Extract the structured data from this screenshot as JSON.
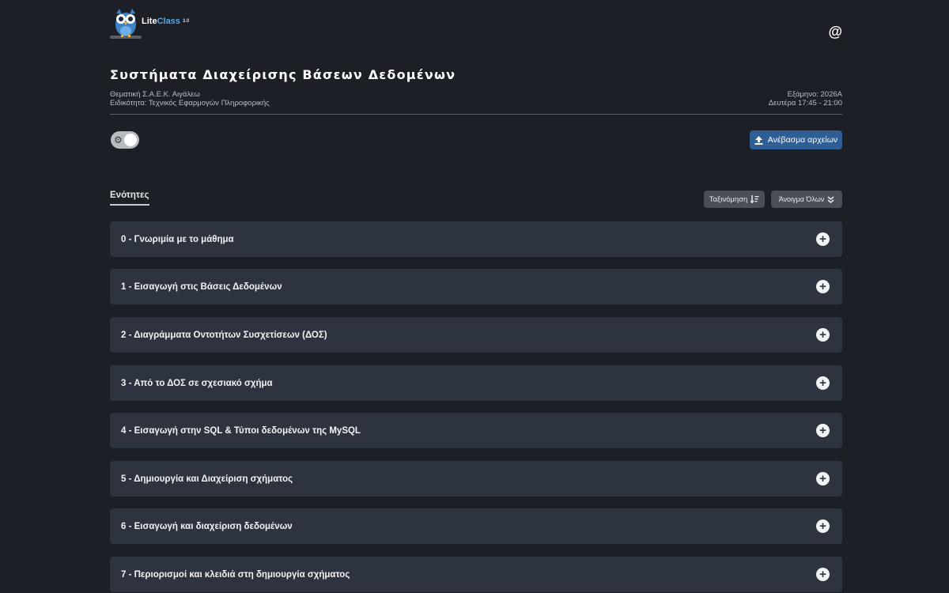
{
  "header": {
    "logo_name": "Lite",
    "logo_name2": "Class",
    "logo_version": "3.0",
    "account_icon": "at-icon"
  },
  "course": {
    "title": "Συστήματα Διαχείρισης Βάσεων Δεδομένων",
    "department": "Θεματική Σ.Α.Ε.Κ. Αιγάλεω",
    "specialty": "Ειδικότητα: Τεχνικός Εφαρμογών Πληροφορικής",
    "semester": "Εξάμηνο: 2026Α",
    "schedule": "Δευτέρα 17:45 - 21:00"
  },
  "toolbar": {
    "upload_label": "Ανέβασμα αρχείων",
    "sections_tab": "Ενότητες",
    "sort_label": "Ταξινόμηση",
    "expand_label": "Άνοιγμα Όλων"
  },
  "sections": [
    {
      "label": "0 - Γνωριμία με το μάθημα"
    },
    {
      "label": "1 - Εισαγωγή στις Βάσεις Δεδομένων"
    },
    {
      "label": "2 - Διαγράμματα Οντοτήτων Συσχετίσεων (ΔΟΣ)"
    },
    {
      "label": "3 - Από το ΔΟΣ σε σχεσιακό σχήμα"
    },
    {
      "label": "4 - Εισαγωγή στην SQL & Τύποι δεδομένων της MySQL"
    },
    {
      "label": "5 - Δημιουργία και Διαχείριση σχήματος"
    },
    {
      "label": "6 - Εισαγωγή και διαχείριση δεδομένων"
    },
    {
      "label": "7 - Περιορισμοί και κλειδιά στη δημιουργία σχήματος"
    }
  ],
  "colors": {
    "background": "#1c1f25",
    "section_bg": "#2d333f",
    "primary_button": "#2f5e94",
    "secondary_button": "#4a4f57"
  }
}
